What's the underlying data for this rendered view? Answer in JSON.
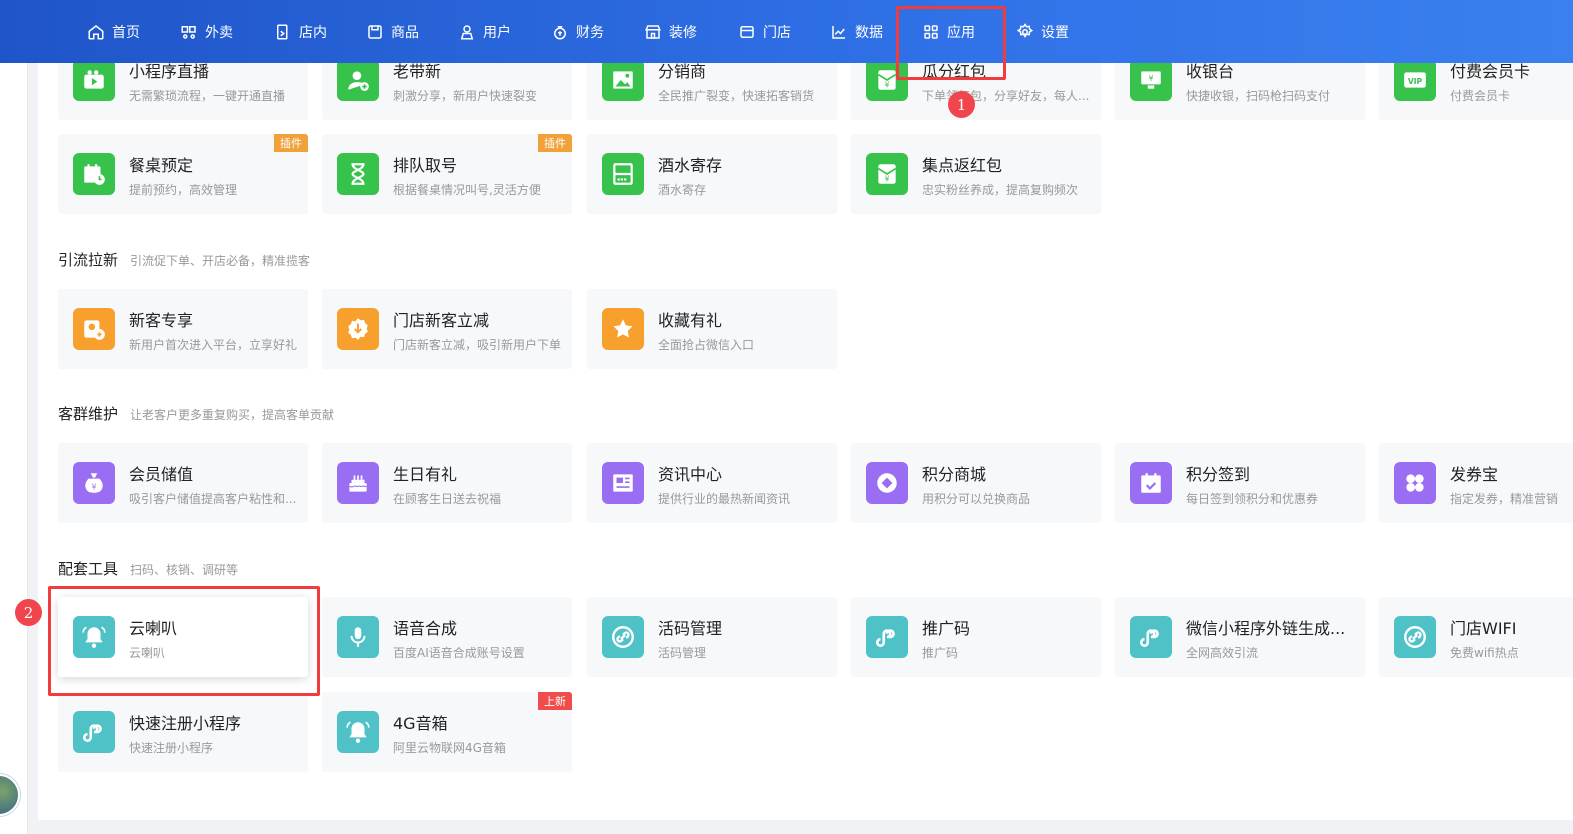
{
  "nav": {
    "items": [
      {
        "label": "首页",
        "icon": "home-icon"
      },
      {
        "label": "外卖",
        "icon": "takeout-icon"
      },
      {
        "label": "店内",
        "icon": "dine-in-icon"
      },
      {
        "label": "商品",
        "icon": "product-icon"
      },
      {
        "label": "用户",
        "icon": "user-icon"
      },
      {
        "label": "财务",
        "icon": "finance-icon"
      },
      {
        "label": "装修",
        "icon": "decoration-icon"
      },
      {
        "label": "门店",
        "icon": "store-icon"
      },
      {
        "label": "数据",
        "icon": "chart-icon"
      },
      {
        "label": "应用",
        "icon": "apps-icon"
      },
      {
        "label": "设置",
        "icon": "gear-icon"
      }
    ]
  },
  "steps": [
    "1",
    "2"
  ],
  "sections": {
    "marketing": {
      "cards": [
        {
          "title": "小程序直播",
          "desc": "无需繁琐流程，一键开通直播"
        },
        {
          "title": "老带新",
          "desc": "刺激分享，新用户快速裂变"
        },
        {
          "title": "分销商",
          "desc": "全民推广裂变，快速拓客销货"
        },
        {
          "title": "瓜分红包",
          "desc": "下单领红包，分享好友，每人..."
        },
        {
          "title": "收银台",
          "desc": "快捷收银，扫码枪扫码支付"
        },
        {
          "title": "付费会员卡",
          "desc": "付费会员卡"
        },
        {
          "title": "餐桌预定",
          "desc": "提前预约，高效管理",
          "tag": "插件"
        },
        {
          "title": "排队取号",
          "desc": "根据餐桌情况叫号,灵活方便",
          "tag": "插件"
        },
        {
          "title": "酒水寄存",
          "desc": "酒水寄存"
        },
        {
          "title": "集点返红包",
          "desc": "忠实粉丝养成，提高复购频次"
        }
      ]
    },
    "traffic": {
      "title": "引流拉新",
      "subtitle": "引流促下单、开店必备，精准揽客",
      "cards": [
        {
          "title": "新客专享",
          "desc": "新用户首次进入平台，立享好礼"
        },
        {
          "title": "门店新客立减",
          "desc": "门店新客立减，吸引新用户下单"
        },
        {
          "title": "收藏有礼",
          "desc": "全面抢占微信入口"
        }
      ]
    },
    "retention": {
      "title": "客群维护",
      "subtitle": "让老客户更多重复购买，提高客单贡献",
      "cards": [
        {
          "title": "会员储值",
          "desc": "吸引客户储值提高客户粘性和..."
        },
        {
          "title": "生日有礼",
          "desc": "在顾客生日送去祝福"
        },
        {
          "title": "资讯中心",
          "desc": "提供行业的最热新闻资讯"
        },
        {
          "title": "积分商城",
          "desc": "用积分可以兑换商品"
        },
        {
          "title": "积分签到",
          "desc": "每日签到领积分和优惠券"
        },
        {
          "title": "发券宝",
          "desc": "指定发券，精准营销"
        }
      ]
    },
    "tools": {
      "title": "配套工具",
      "subtitle": "扫码、核销、调研等",
      "cards": [
        {
          "title": "云喇叭",
          "desc": "云喇叭"
        },
        {
          "title": "语音合成",
          "desc": "百度AI语音合成账号设置"
        },
        {
          "title": "活码管理",
          "desc": "活码管理"
        },
        {
          "title": "推广码",
          "desc": "推广码"
        },
        {
          "title": "微信小程序外链生成...",
          "desc": "全网高效引流"
        },
        {
          "title": "门店WIFI",
          "desc": "免费wifi热点"
        },
        {
          "title": "快速注册小程序",
          "desc": "快速注册小程序"
        },
        {
          "title": "4G音箱",
          "desc": "阿里云物联网4G音箱",
          "tag": "上新"
        }
      ]
    }
  }
}
